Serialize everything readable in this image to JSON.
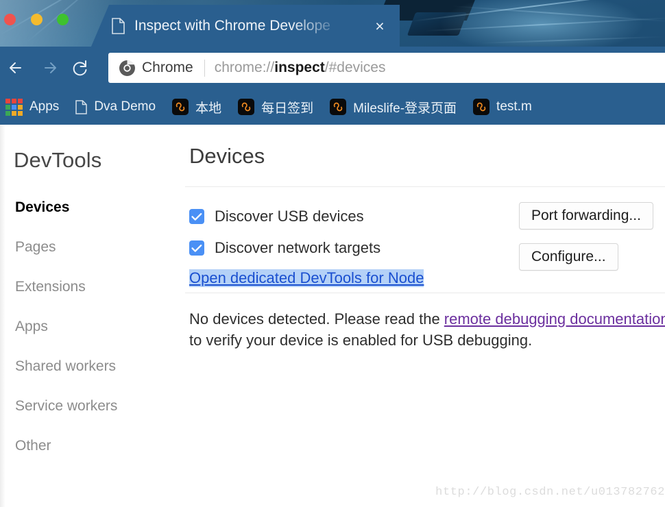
{
  "window": {
    "traffic_lights": [
      {
        "name": "close",
        "color": "#f0534e"
      },
      {
        "name": "minimize",
        "color": "#f5bb2e"
      },
      {
        "name": "maximize",
        "color": "#3ec22f"
      }
    ]
  },
  "tab": {
    "title": "Inspect with Chrome Develope",
    "close_label": "×",
    "favicon": "document-icon"
  },
  "toolbar": {
    "back_icon": "arrow-left-icon",
    "forward_icon": "arrow-right-icon",
    "reload_icon": "reload-icon",
    "security_chip": "Chrome",
    "url_prefix": "chrome://",
    "url_host": "inspect",
    "url_suffix": "/#devices",
    "full_url": "chrome://inspect/#devices"
  },
  "bookmarks": [
    {
      "label": "Apps",
      "icon": "apps-grid-icon"
    },
    {
      "label": "Dva Demo",
      "icon": "document-icon"
    },
    {
      "label": "本地",
      "icon": "site-favicon"
    },
    {
      "label": "每日签到",
      "icon": "site-favicon"
    },
    {
      "label": "Mileslife-登录页面",
      "icon": "site-favicon"
    },
    {
      "label": "test.m",
      "icon": "site-favicon"
    }
  ],
  "sidebar": {
    "title": "DevTools",
    "items": [
      {
        "label": "Devices",
        "active": true
      },
      {
        "label": "Pages",
        "active": false
      },
      {
        "label": "Extensions",
        "active": false
      },
      {
        "label": "Apps",
        "active": false
      },
      {
        "label": "Shared workers",
        "active": false
      },
      {
        "label": "Service workers",
        "active": false
      },
      {
        "label": "Other",
        "active": false
      }
    ]
  },
  "main": {
    "title": "Devices",
    "discover_usb": {
      "label": "Discover USB devices",
      "checked": true
    },
    "discover_network": {
      "label": "Discover network targets",
      "checked": true
    },
    "port_forwarding_button": "Port forwarding...",
    "configure_button": "Configure...",
    "node_link": "Open dedicated DevTools for Node",
    "notice": {
      "lead": "No devices detected. Please read the ",
      "link": "remote debugging documentation",
      "tail": " to verify your device is enabled for USB debugging."
    }
  },
  "watermark": "http://blog.csdn.net/u013782762",
  "colors": {
    "chrome_blue": "#2a5f8f",
    "checkbox_blue": "#4a90f5",
    "link_blue": "#1a4fd0",
    "selection_blue": "#b4d1f7",
    "visited_purple": "#6b2f9e"
  }
}
